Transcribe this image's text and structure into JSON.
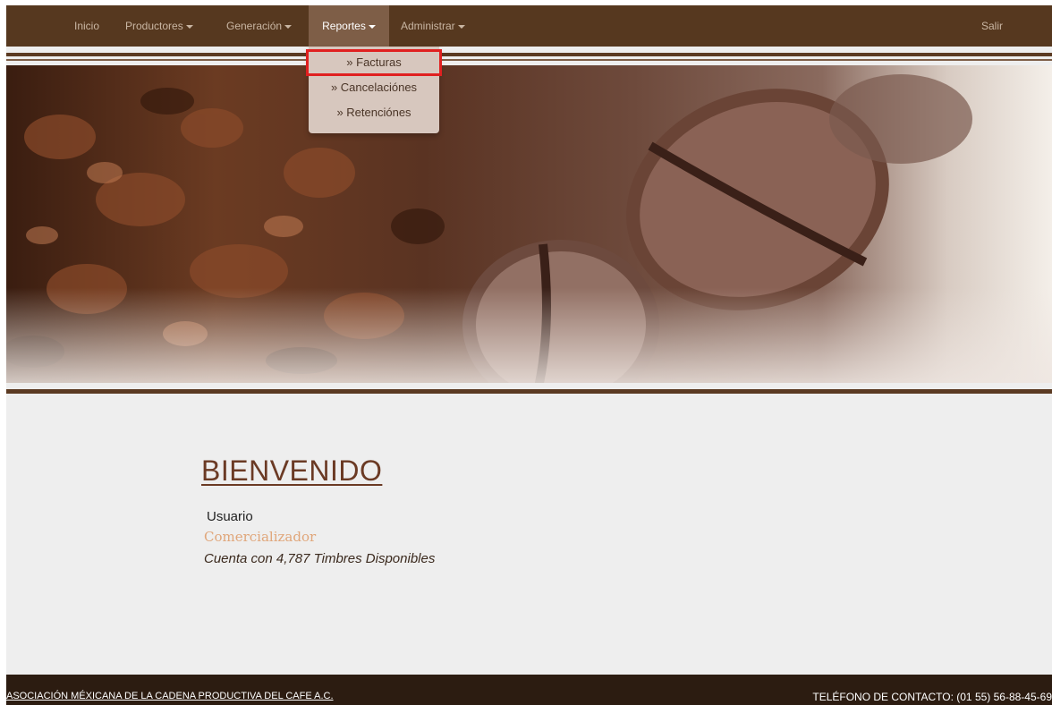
{
  "navbar": {
    "items": [
      {
        "label": "Inicio",
        "has_caret": false
      },
      {
        "label": "Productores",
        "has_caret": true
      },
      {
        "label": "Generación",
        "has_caret": true
      },
      {
        "label": "Reportes",
        "has_caret": true,
        "active": true
      },
      {
        "label": "Administrar",
        "has_caret": true
      }
    ],
    "logout_label": "Salir"
  },
  "dropdown": {
    "items": [
      "» Facturas",
      "» Cancelaciónes",
      "» Retenciónes"
    ],
    "highlighted_index": 0
  },
  "welcome": {
    "title": "BIENVENIDO",
    "user_name": "Usuario",
    "user_role": "Comercializador",
    "stamps_text": "Cuenta con 4,787 Timbres Disponibles"
  },
  "footer": {
    "org_name": "ASOCIACIÓN MÉXICANA DE LA CADENA PRODUCTIVA DEL CAFE A.C.",
    "contact": "TELÉFONO DE CONTACTO: (01 55) 56-88-45-69"
  },
  "colors": {
    "navbar": "#56381f",
    "active_tab": "#7e5e47",
    "dropdown": "#d7c7be",
    "highlight": "#e02020",
    "footer": "#2c1c11"
  }
}
